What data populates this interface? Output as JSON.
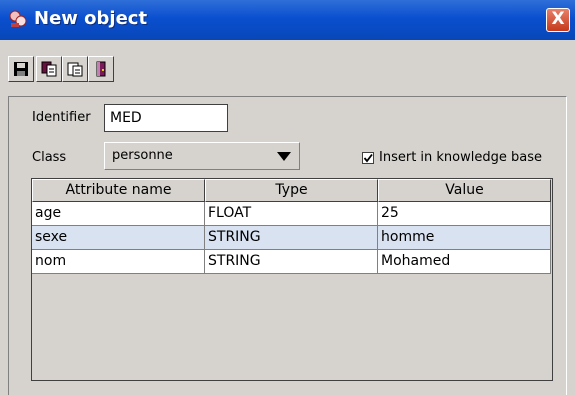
{
  "window": {
    "title": "New object",
    "close_label": "X"
  },
  "toolbar": {
    "buttons": [
      {
        "name": "save-button",
        "icon": "floppy-disk-icon"
      },
      {
        "name": "copy-button",
        "icon": "copy-icon"
      },
      {
        "name": "paste-button",
        "icon": "paste-icon"
      },
      {
        "name": "exit-button",
        "icon": "door-exit-icon"
      }
    ]
  },
  "form": {
    "identifier_label": "Identifier",
    "identifier_value": "MED",
    "class_label": "Class",
    "class_value": "personne",
    "insert_checkbox_label": "Insert in knowledge base",
    "insert_checked": true
  },
  "table": {
    "columns": [
      "Attribute name",
      "Type",
      "Value"
    ],
    "rows": [
      [
        "age",
        "FLOAT",
        "25"
      ],
      [
        "sexe",
        "STRING",
        "homme"
      ],
      [
        "nom",
        "STRING",
        "Mohamed"
      ]
    ],
    "selected_row": 1
  },
  "colors": {
    "titlebar": "#0a4fcf",
    "window_bg": "#d6d3ce",
    "selected_row": "#d9e2f1",
    "close": "#c43a1a"
  }
}
